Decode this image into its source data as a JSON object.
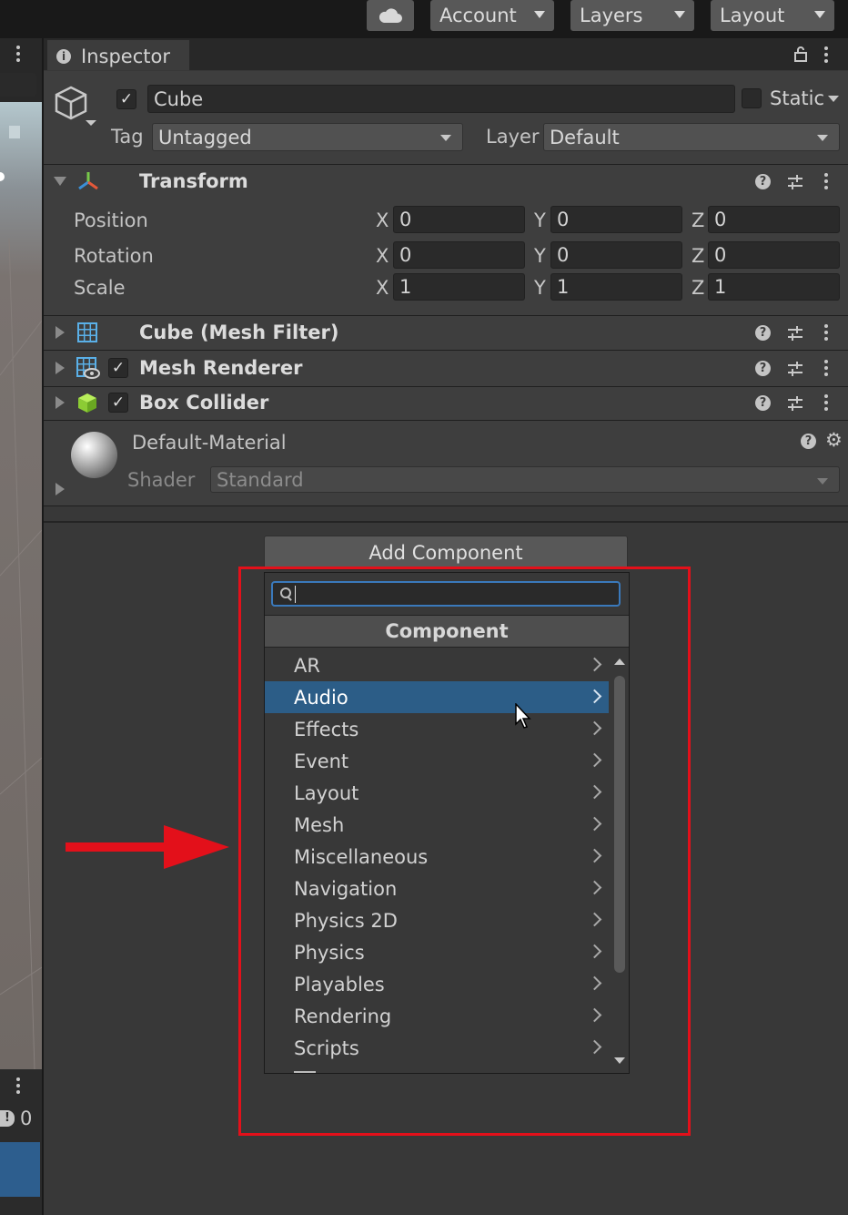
{
  "toolbar": {
    "cloud_icon": "cloud-icon",
    "account": "Account",
    "layers": "Layers",
    "layout": "Layout"
  },
  "left_panel": {
    "console_count": "0"
  },
  "inspector_tab": {
    "label": "Inspector",
    "icon": "info-icon"
  },
  "gameobject": {
    "active": true,
    "name": "Cube",
    "static_label": "Static",
    "tag_label": "Tag",
    "tag_value": "Untagged",
    "layer_label": "Layer",
    "layer_value": "Default"
  },
  "transform": {
    "title": "Transform",
    "rows": [
      {
        "label": "Position",
        "x": "0",
        "y": "0",
        "z": "0"
      },
      {
        "label": "Rotation",
        "x": "0",
        "y": "0",
        "z": "0"
      },
      {
        "label": "Scale",
        "x": "1",
        "y": "1",
        "z": "1"
      }
    ],
    "axes": {
      "x": "X",
      "y": "Y",
      "z": "Z"
    }
  },
  "components": [
    {
      "title": "Cube (Mesh Filter)",
      "icon": "mesh-filter-icon",
      "has_checkbox": false
    },
    {
      "title": "Mesh Renderer",
      "icon": "mesh-renderer-icon",
      "has_checkbox": true
    },
    {
      "title": "Box Collider",
      "icon": "box-collider-icon",
      "has_checkbox": true
    }
  ],
  "material": {
    "name": "Default-Material",
    "shader_label": "Shader",
    "shader_value": "Standard"
  },
  "add_component": {
    "button_label": "Add Component",
    "search_value": "",
    "header": "Component",
    "items": [
      "AR",
      "Audio",
      "Effects",
      "Event",
      "Layout",
      "Mesh",
      "Miscellaneous",
      "Navigation",
      "Physics 2D",
      "Physics",
      "Playables",
      "Rendering",
      "Scripts"
    ],
    "selected": "Audio"
  },
  "colors": {
    "selection": "#2c5d87",
    "highlight_box": "#e3101a",
    "annotation_arrow": "#e3101a",
    "search_focus": "#3a79bb"
  }
}
